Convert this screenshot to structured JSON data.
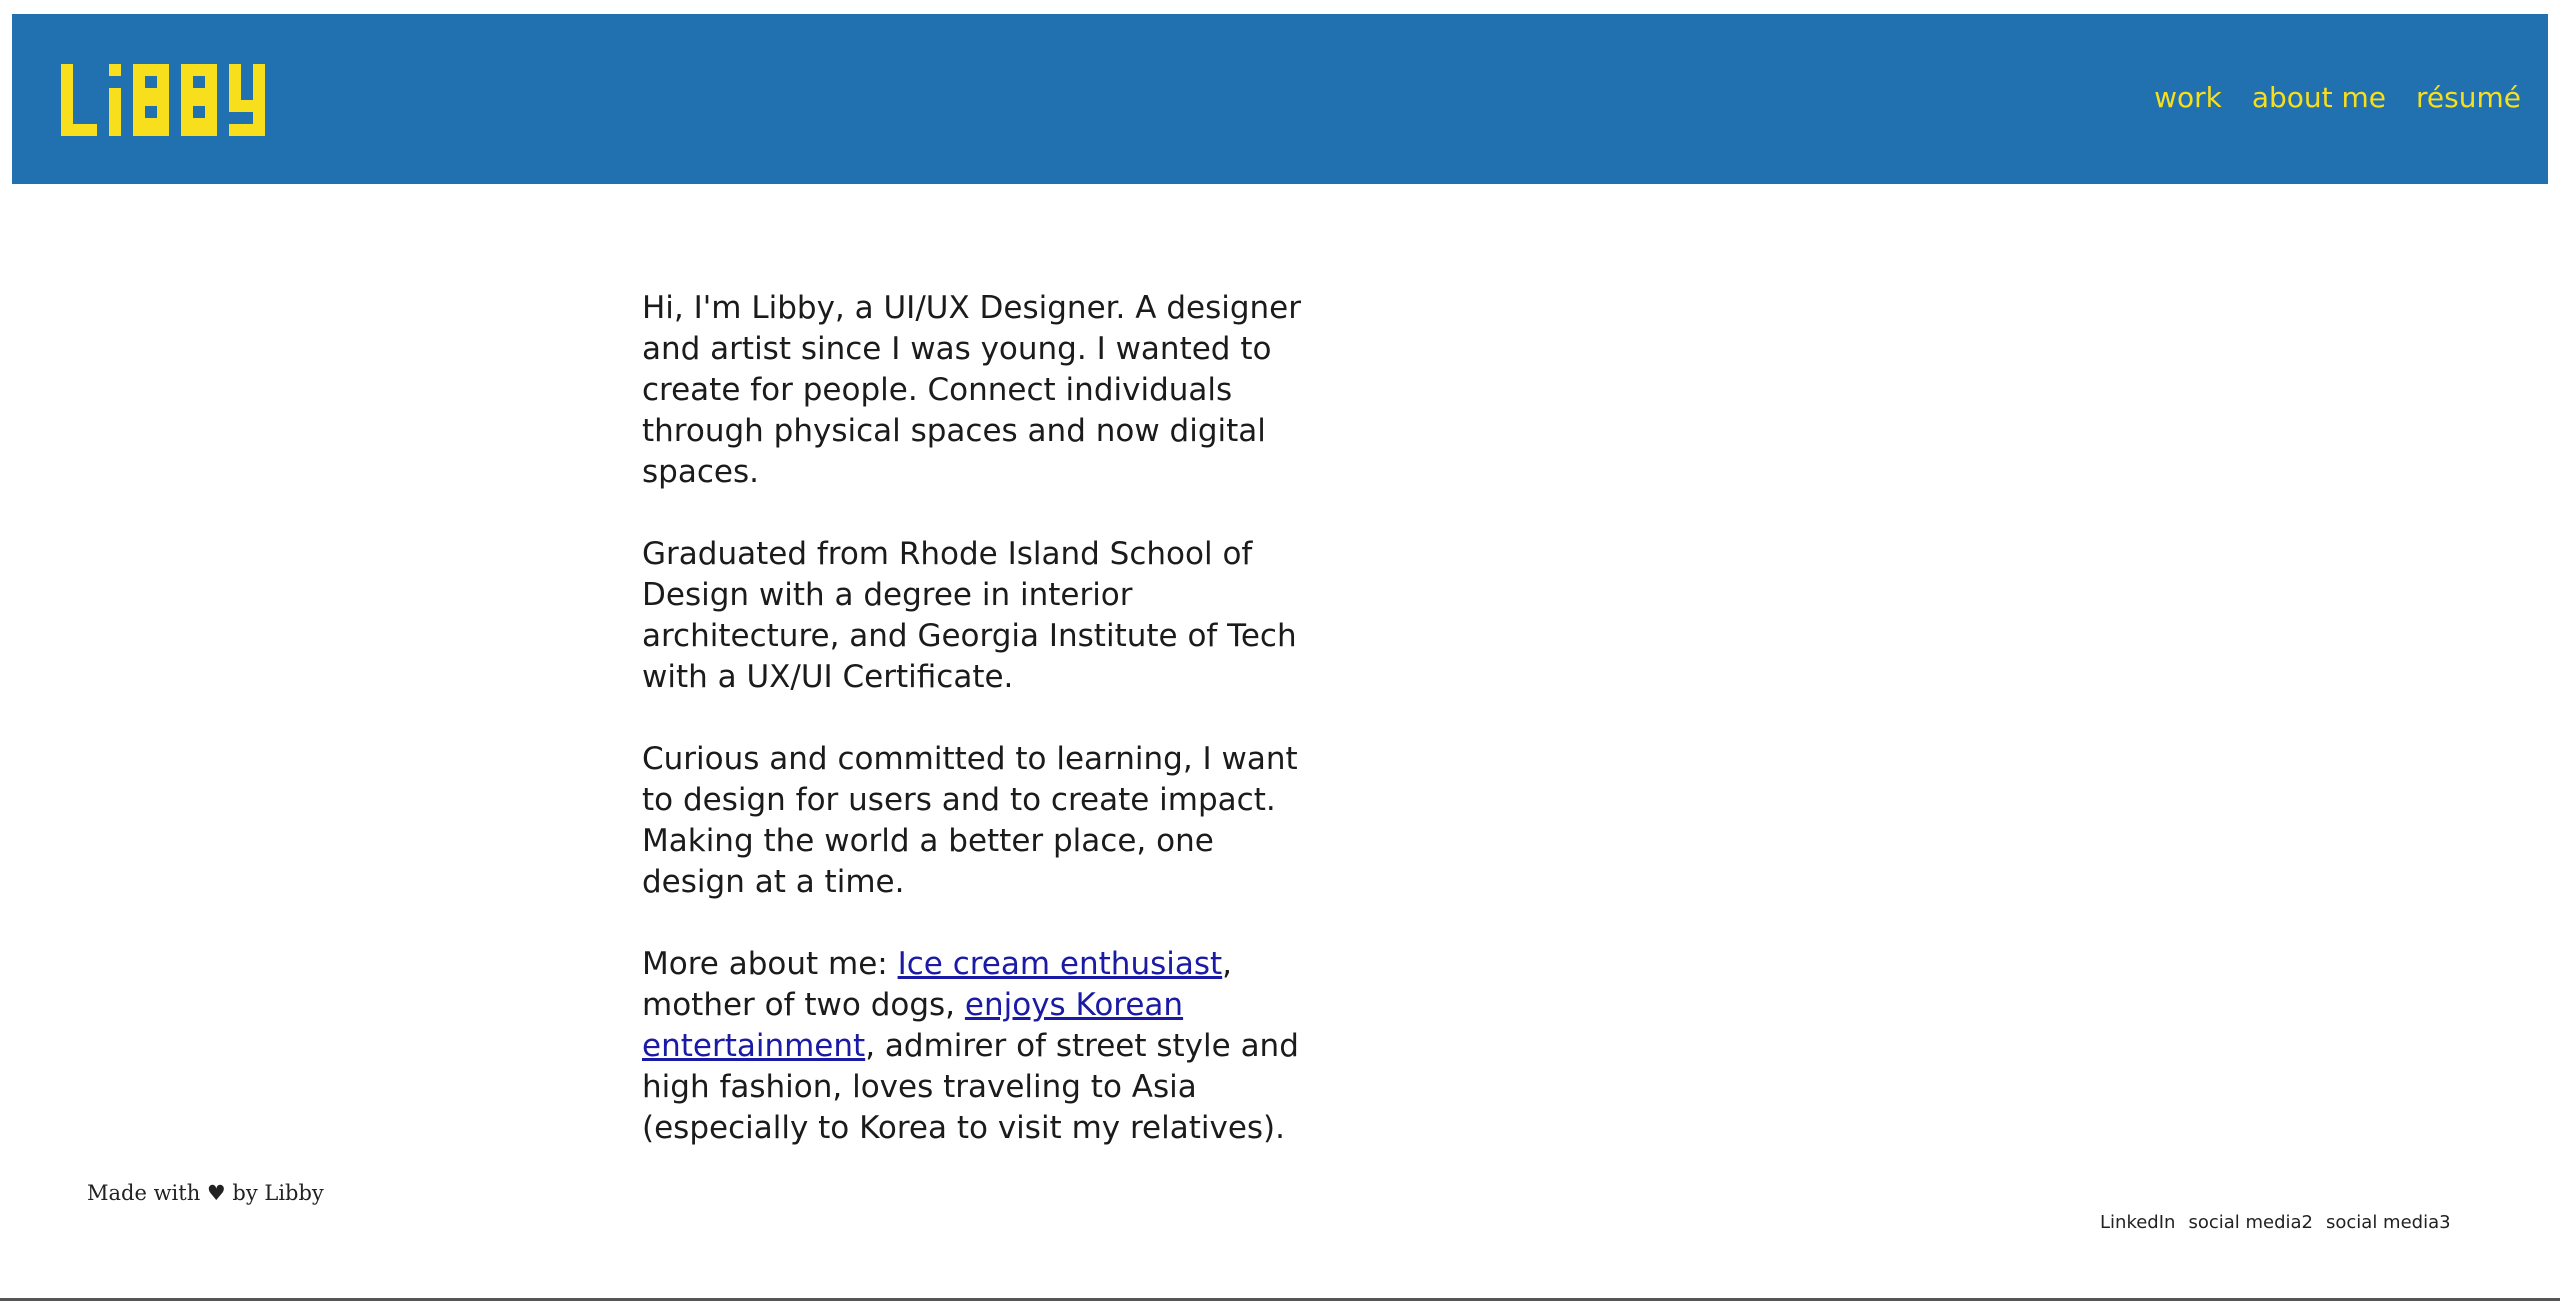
{
  "header": {
    "logo_text": "Libby",
    "nav": [
      "work",
      "about me",
      "résumé"
    ]
  },
  "about": {
    "paragraph_1": "Hi, I'm Libby, a UI/UX Designer. A designer and artist since I was young. I wanted to create for people. Connect individuals through physical spaces and now digital spaces.",
    "paragraph_2": "Graduated from Rhode Island School of Design with a degree in interior architecture, and Georgia Institute of Tech with a UX/UI Certificate.",
    "paragraph_3": "Curious and committed to learning, I want to design for users and to create impact. Making the world a better place, one design at a time.",
    "paragraph_4": {
      "prefix": "More about me: ",
      "link_1": "Ice cream enthusiast",
      "middle": ", mother of two dogs, ",
      "link_2": "enjoys Korean entertainment",
      "suffix": ", admirer of street style and high fashion, loves traveling to Asia (especially to Korea to visit my relatives)."
    }
  },
  "footer": {
    "made_with": "Made with ♥ by Libby",
    "links": [
      "LinkedIn",
      "social media2",
      "social media3"
    ]
  },
  "colors": {
    "header_bg": "#2171b1",
    "accent_yellow": "#f7df1e",
    "link_blue": "#1a1aa6"
  }
}
